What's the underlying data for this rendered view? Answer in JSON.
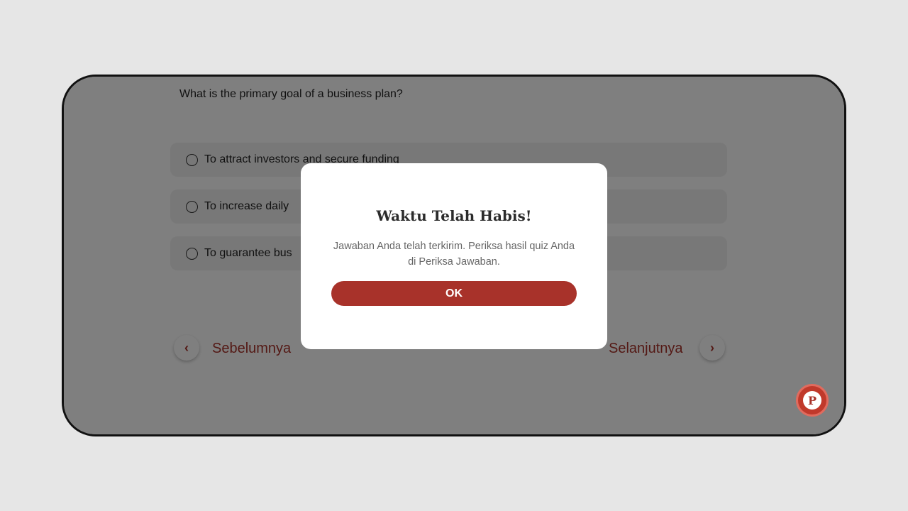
{
  "quiz": {
    "question": "What is the primary goal of a business plan?",
    "options": [
      {
        "label": "To attract investors and secure funding"
      },
      {
        "label": "To increase daily"
      },
      {
        "label": "To guarantee bus"
      }
    ],
    "prev_label": "Sebelumnya",
    "next_label": "Selanjutnya",
    "prev_icon": "‹",
    "next_icon": "›"
  },
  "fab": {
    "glyph": "P",
    "icon": "p-chat-icon"
  },
  "modal": {
    "title": "Waktu Telah Habis!",
    "message": "Jawaban Anda telah terkirim. Periksa hasil quiz Anda di Periksa Jawaban.",
    "ok_label": "OK"
  },
  "colors": {
    "accent": "#a8322a",
    "overlay": "rgba(0,0,0,0.5)",
    "page_bg": "#e6e6e6"
  }
}
